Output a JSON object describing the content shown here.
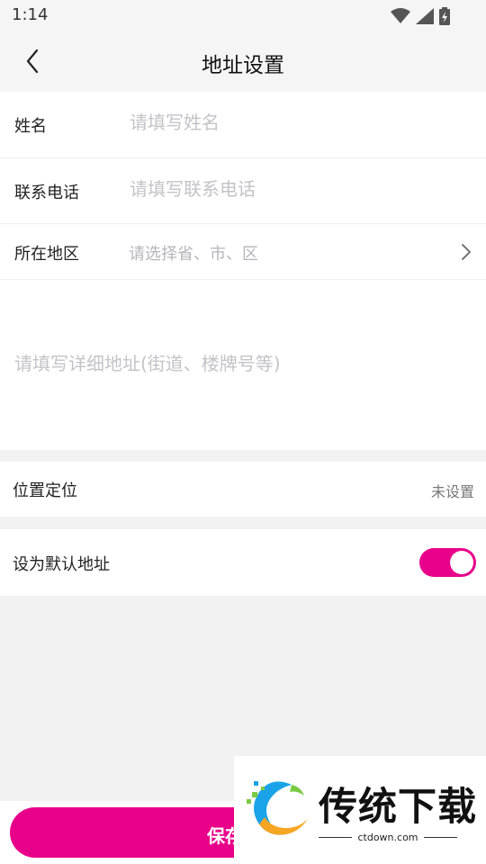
{
  "status_bar": {
    "time": "1:14",
    "icons": [
      "wifi-icon",
      "signal-icon",
      "battery-charging-icon"
    ]
  },
  "header": {
    "title": "地址设置",
    "back_icon": "chevron-left-icon"
  },
  "form": {
    "name": {
      "label": "姓名",
      "placeholder": "请填写姓名",
      "value": ""
    },
    "phone": {
      "label": "联系电话",
      "placeholder": "请填写联系电话",
      "value": ""
    },
    "region": {
      "label": "所在地区",
      "placeholder": "请选择省、市、区",
      "icon": "chevron-right-icon"
    },
    "detail": {
      "placeholder": "请填写详细地址(街道、楼牌号等)",
      "value": ""
    }
  },
  "location": {
    "label": "位置定位",
    "value": "未设置"
  },
  "default_address": {
    "label": "设为默认地址",
    "enabled": true,
    "accent_color": "#e8008a"
  },
  "footer": {
    "save_label": "保存"
  },
  "watermark": {
    "brand": "传统下载",
    "url": "ctdown.com",
    "logo_icon": "ctdown-logo-icon"
  }
}
